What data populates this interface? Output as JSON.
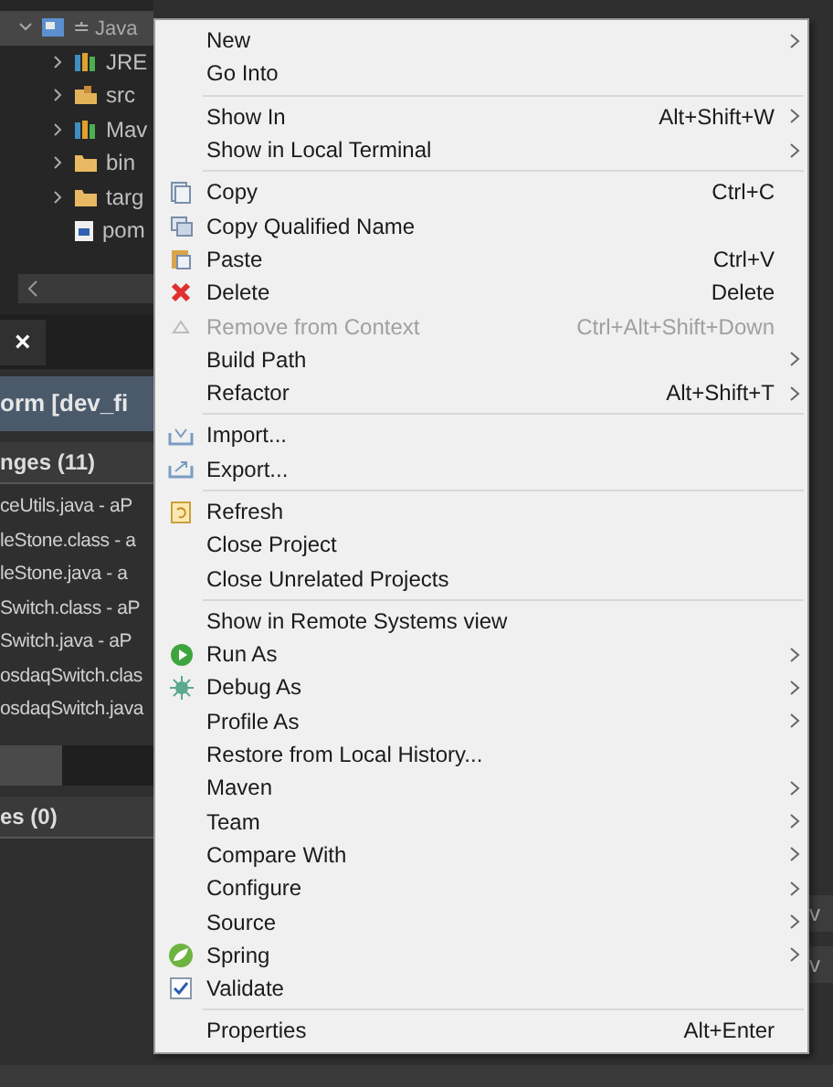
{
  "project_tree": {
    "project": {
      "label": "≐ Java",
      "expanded": true
    },
    "children": [
      {
        "label": "JRE",
        "kind": "library",
        "expandable": true
      },
      {
        "label": "src",
        "kind": "package",
        "expandable": true
      },
      {
        "label": "Mav",
        "kind": "library",
        "expandable": true
      },
      {
        "label": "bin",
        "kind": "folder",
        "expandable": true
      },
      {
        "label": "targ",
        "kind": "folder",
        "expandable": true
      },
      {
        "label": "pom",
        "kind": "file",
        "expandable": false
      }
    ]
  },
  "view_tab": {
    "close": "×"
  },
  "repository_header": "orm [dev_fi",
  "changes": {
    "title": "nges (11)",
    "files": [
      "ceUtils.java - aP",
      "leStone.class - a",
      "leStone.java - a",
      "Switch.class - aP",
      "Switch.java - aP",
      "osdaqSwitch.clas",
      "osdaqSwitch.java"
    ]
  },
  "staged": {
    "title": "es (0)"
  },
  "right_fields": [
    "v",
    "v"
  ],
  "context_menu": {
    "groups": [
      [
        {
          "label": "New",
          "submenu": true,
          "disabled": false
        },
        {
          "label": "Go Into",
          "submenu": false,
          "disabled": false
        }
      ],
      [
        {
          "label": "Show In",
          "shortcut": "Alt+Shift+W",
          "submenu": true,
          "disabled": false
        },
        {
          "label": "Show in Local Terminal",
          "submenu": true,
          "disabled": false
        }
      ],
      [
        {
          "label": "Copy",
          "shortcut": "Ctrl+C",
          "submenu": false,
          "disabled": false,
          "kind": "copy"
        },
        {
          "label": "Copy Qualified Name",
          "submenu": false,
          "disabled": false,
          "kind": "copy2"
        },
        {
          "label": "Paste",
          "shortcut": "Ctrl+V",
          "submenu": false,
          "disabled": false,
          "kind": "paste"
        },
        {
          "label": "Delete",
          "shortcut": "Delete",
          "submenu": false,
          "disabled": false,
          "kind": "delete"
        },
        {
          "label": "Remove from Context",
          "shortcut": "Ctrl+Alt+Shift+Down",
          "submenu": false,
          "disabled": true,
          "kind": "remove"
        },
        {
          "label": "Build Path",
          "submenu": true,
          "disabled": false
        },
        {
          "label": "Refactor",
          "shortcut": "Alt+Shift+T",
          "submenu": true,
          "disabled": false
        }
      ],
      [
        {
          "label": "Import...",
          "submenu": false,
          "disabled": false,
          "kind": "import"
        },
        {
          "label": "Export...",
          "submenu": false,
          "disabled": false,
          "kind": "export"
        }
      ],
      [
        {
          "label": "Refresh",
          "submenu": false,
          "disabled": false,
          "kind": "refresh"
        },
        {
          "label": "Close Project",
          "submenu": false,
          "disabled": false
        },
        {
          "label": "Close Unrelated Projects",
          "submenu": false,
          "disabled": false
        }
      ],
      [
        {
          "label": "Show in Remote Systems view",
          "submenu": false,
          "disabled": false
        },
        {
          "label": "Run As",
          "submenu": true,
          "disabled": false,
          "kind": "run"
        },
        {
          "label": "Debug As",
          "submenu": true,
          "disabled": false,
          "kind": "debug"
        },
        {
          "label": "Profile As",
          "submenu": true,
          "disabled": false
        },
        {
          "label": "Restore from Local History...",
          "submenu": false,
          "disabled": false
        },
        {
          "label": "Maven",
          "submenu": true,
          "disabled": false
        },
        {
          "label": "Team",
          "submenu": true,
          "disabled": false
        },
        {
          "label": "Compare With",
          "submenu": true,
          "disabled": false
        },
        {
          "label": "Configure",
          "submenu": true,
          "disabled": false
        },
        {
          "label": "Source",
          "submenu": true,
          "disabled": false
        },
        {
          "label": "Spring",
          "submenu": true,
          "disabled": false,
          "kind": "spring"
        },
        {
          "label": "Validate",
          "submenu": false,
          "disabled": false,
          "kind": "check"
        }
      ],
      [
        {
          "label": "Properties",
          "shortcut": "Alt+Enter",
          "submenu": false,
          "disabled": false
        }
      ]
    ]
  }
}
